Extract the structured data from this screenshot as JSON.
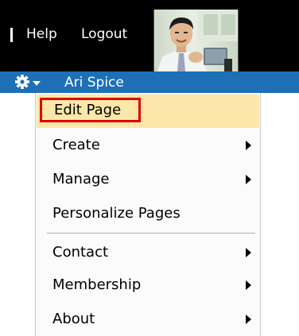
{
  "topbar": {
    "help_label": "Help",
    "logout_label": "Logout"
  },
  "userbar": {
    "username": "Ari Spice",
    "settings_icon": "gear-icon"
  },
  "menu": {
    "items": [
      {
        "label": "Edit Page",
        "submenu": false,
        "highlighted": true
      },
      {
        "label": "Create",
        "submenu": true
      },
      {
        "label": "Manage",
        "submenu": true
      },
      {
        "label": "Personalize Pages",
        "submenu": false
      },
      {
        "label": "Contact",
        "submenu": true
      },
      {
        "label": "Membership",
        "submenu": true
      },
      {
        "label": "About",
        "submenu": true
      }
    ]
  },
  "colors": {
    "topbar": "#000000",
    "userbar": "#1e6fb6",
    "highlight": "#fbe7a9",
    "callout": "#e00000"
  }
}
